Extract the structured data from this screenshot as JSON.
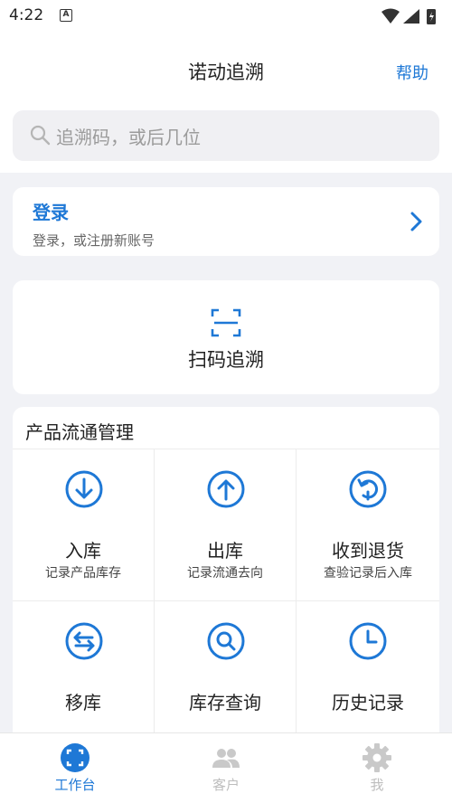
{
  "status_bar": {
    "time": "4:22",
    "notification_letter": "A"
  },
  "header": {
    "title": "诺动追溯",
    "help_label": "帮助"
  },
  "search": {
    "placeholder": "追溯码，或后几位"
  },
  "login": {
    "title": "登录",
    "subtitle": "登录，或注册新账号"
  },
  "scan": {
    "label": "扫码追溯"
  },
  "management": {
    "title": "产品流通管理",
    "items": [
      {
        "label": "入库",
        "sub": "记录产品库存",
        "icon": "arrow-down-circle-icon"
      },
      {
        "label": "出库",
        "sub": "记录流通去向",
        "icon": "arrow-up-circle-icon"
      },
      {
        "label": "收到退货",
        "sub": "查验记录后入库",
        "icon": "return-circle-icon"
      },
      {
        "label": "移库",
        "sub": "",
        "icon": "transfer-circle-icon"
      },
      {
        "label": "库存查询",
        "sub": "",
        "icon": "search-circle-icon"
      },
      {
        "label": "历史记录",
        "sub": "",
        "icon": "clock-circle-icon"
      }
    ]
  },
  "tabbar": {
    "tabs": [
      {
        "label": "工作台",
        "active": true
      },
      {
        "label": "客户",
        "active": false
      },
      {
        "label": "我",
        "active": false
      }
    ]
  },
  "colors": {
    "accent": "#1e78d6",
    "inactive": "#c9c9c9",
    "background": "#f1f2f6"
  }
}
